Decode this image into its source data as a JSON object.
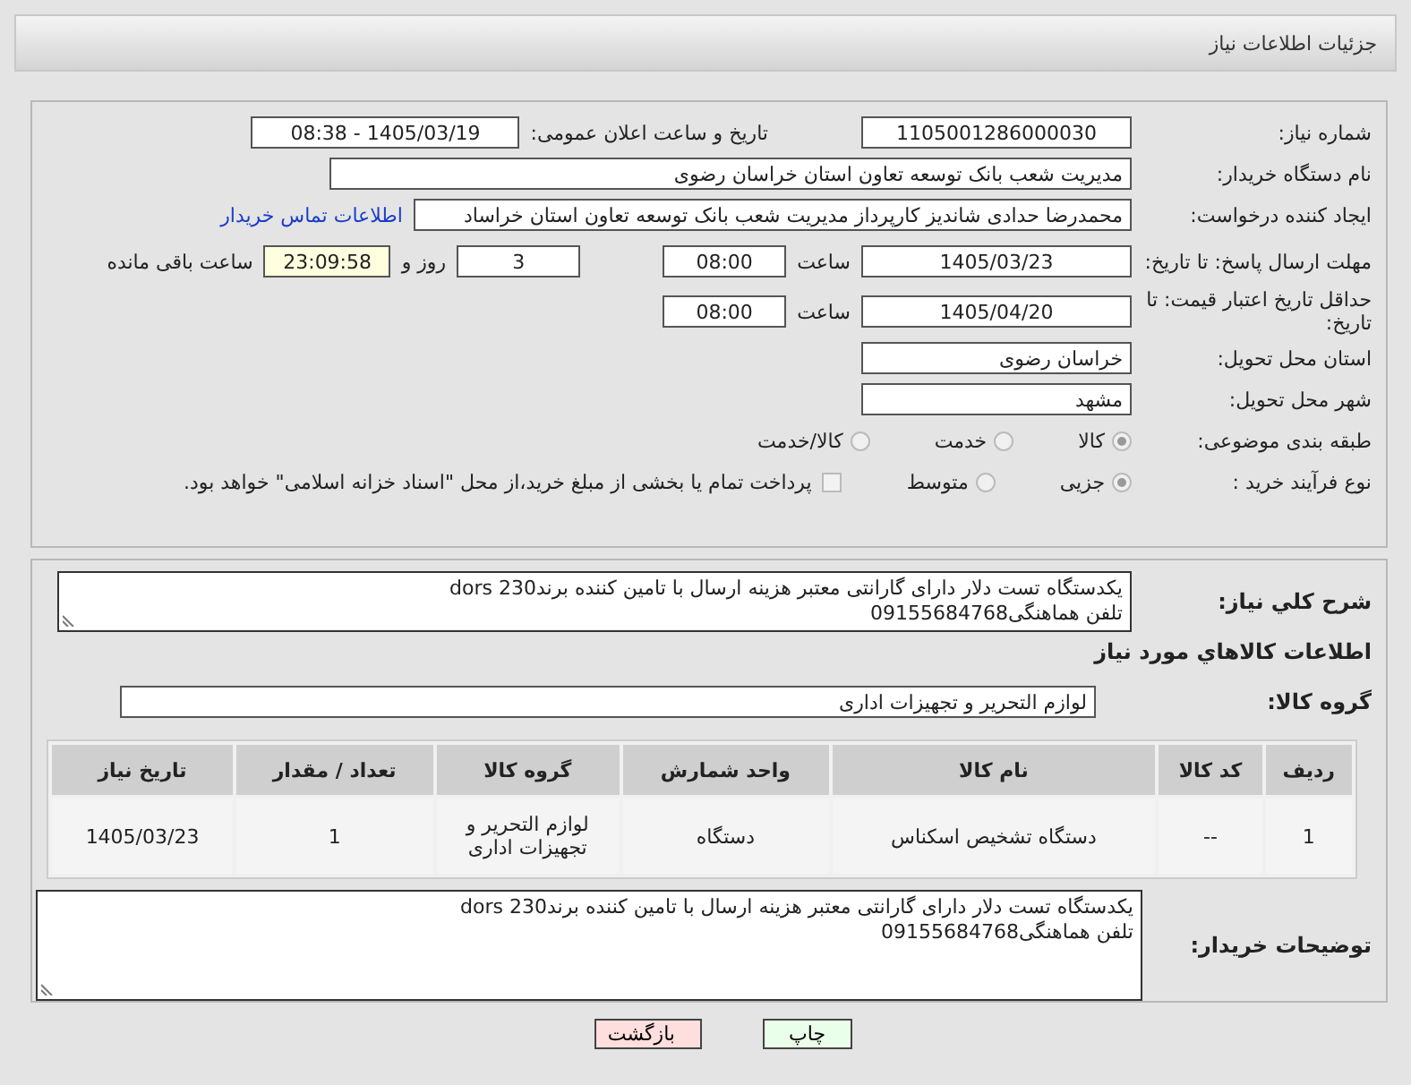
{
  "header": {
    "title": "جزئیات اطلاعات نیاز"
  },
  "need_number": {
    "label": "شماره نیاز:",
    "value": "1105001286000030"
  },
  "announce": {
    "label": "تاریخ و ساعت اعلان عمومی:",
    "value": "1405/03/19 - 08:38"
  },
  "buyer_org": {
    "label": "نام دستگاه خریدار:",
    "value": "مدیریت شعب بانک توسعه تعاون استان خراسان رضوی"
  },
  "creator": {
    "label": "ایجاد کننده درخواست:",
    "value": "محمدرضا حدادی شاندیز کارپرداز مدیریت شعب بانک توسعه تعاون استان خراساد",
    "link": "اطلاعات تماس خریدار"
  },
  "reply_deadline": {
    "label": "مهلت ارسال پاسخ: تا تاریخ:",
    "date": "1405/03/23",
    "time_label": "ساعت",
    "time": "08:00",
    "days": "3",
    "days_label": "روز و",
    "remaining": "23:09:58",
    "remaining_label": "ساعت باقی مانده"
  },
  "price_validity": {
    "label": "حداقل تاریخ اعتبار قیمت: تا تاریخ:",
    "date": "1405/04/20",
    "time_label": "ساعت",
    "time": "08:00"
  },
  "delivery_province": {
    "label": "استان محل تحویل:",
    "value": "خراسان رضوی"
  },
  "delivery_city": {
    "label": "شهر محل تحویل:",
    "value": "مشهد"
  },
  "category": {
    "label": "طبقه بندی موضوعی:",
    "options": [
      {
        "label": "کالا",
        "selected": true
      },
      {
        "label": "خدمت",
        "selected": false
      },
      {
        "label": "کالا/خدمت",
        "selected": false
      }
    ]
  },
  "purchase_process": {
    "label": "نوع فرآیند خرید :",
    "options": [
      {
        "label": "جزیی",
        "selected": true
      },
      {
        "label": "متوسط",
        "selected": false
      }
    ],
    "payment_checkbox": {
      "label": "پرداخت تمام یا بخشی از مبلغ خرید،از محل \"اسناد خزانه اسلامی\" خواهد بود.",
      "checked": false
    }
  },
  "description": {
    "label": "شرح کلي نياز:",
    "lines": [
      "یکدستگاه تست دلار دارای گارانتی معتبر هزینه ارسال با تامین کننده برندdors 230",
      "تلفن هماهنگی09155684768"
    ]
  },
  "goods_section": {
    "title": "اطلاعات کالاهاي مورد نياز"
  },
  "goods_group": {
    "label": "گروه کالا:",
    "value": "لوازم التحریر و تجهیزات اداری"
  },
  "table": {
    "columns": [
      "ردیف",
      "کد کالا",
      "نام کالا",
      "واحد شمارش",
      "گروه کالا",
      "تعداد / مقدار",
      "تاریخ نیاز"
    ],
    "rows": [
      [
        "1",
        "--",
        "دستگاه تشخیص اسکناس",
        "دستگاه",
        "لوازم التحریر و تجهیزات اداری",
        "1",
        "1405/03/23"
      ]
    ]
  },
  "buyer_notes": {
    "label": "توضیحات خریدار:",
    "lines": [
      "یکدستگاه تست دلار دارای گارانتی معتبر هزینه ارسال با تامین کننده برندdors 230",
      "تلفن هماهنگی09155684768"
    ]
  },
  "buttons": [
    {
      "label": "چاپ",
      "kind": "print"
    },
    {
      "label": "بازگشت",
      "kind": "back"
    }
  ]
}
